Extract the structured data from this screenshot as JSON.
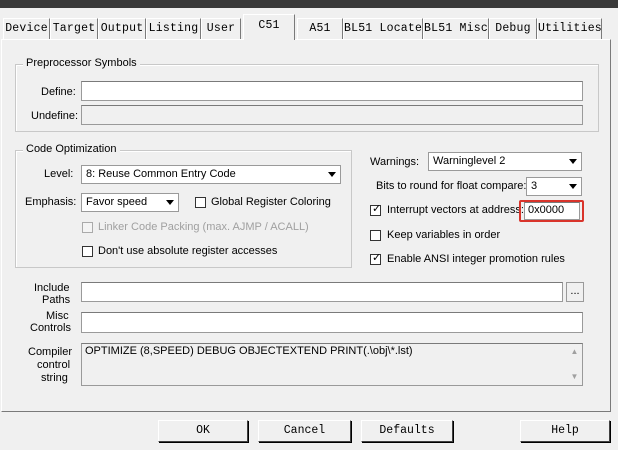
{
  "tabs": [
    {
      "label": "Device"
    },
    {
      "label": "Target"
    },
    {
      "label": "Output"
    },
    {
      "label": "Listing"
    },
    {
      "label": "User"
    },
    {
      "label": "C51"
    },
    {
      "label": "A51"
    },
    {
      "label": "BL51 Locate"
    },
    {
      "label": "BL51 Misc"
    },
    {
      "label": "Debug"
    },
    {
      "label": "Utilities"
    }
  ],
  "active_tab": "C51",
  "preprocessor": {
    "title": "Preprocessor Symbols",
    "define_label": "Define:",
    "define_value": "",
    "undefine_label": "Undefine:",
    "undefine_value": ""
  },
  "code_opt": {
    "title": "Code Optimization",
    "level_label": "Level:",
    "level_value": "8: Reuse Common Entry Code",
    "emphasis_label": "Emphasis:",
    "emphasis_value": "Favor speed",
    "global_reg_label": "Global Register Coloring",
    "linker_packing_label": "Linker Code Packing (max. AJMP / ACALL)",
    "abs_reg_label": "Don't use absolute register accesses"
  },
  "right_opts": {
    "warnings_label": "Warnings:",
    "warnings_value": "Warninglevel 2",
    "bits_label": "Bits to round for float compare:",
    "bits_value": "3",
    "interrupt_label": "Interrupt vectors at address:",
    "interrupt_value": "0x0000",
    "keep_vars_label": "Keep variables in order",
    "ansi_label": "Enable ANSI integer promotion rules",
    "highlight_color": "#d9342b"
  },
  "include": {
    "label_line1": "Include",
    "label_line2": "Paths",
    "value": "",
    "browse_label": "..."
  },
  "misc": {
    "label_line1": "Misc",
    "label_line2": "Controls",
    "value": ""
  },
  "compiler": {
    "label_line1": "Compiler",
    "label_line2": "control",
    "label_line3": "string",
    "value": "OPTIMIZE (8,SPEED) DEBUG OBJECTEXTEND PRINT(.\\obj\\*.lst)"
  },
  "buttons": {
    "ok": "OK",
    "cancel": "Cancel",
    "defaults": "Defaults",
    "help": "Help"
  }
}
